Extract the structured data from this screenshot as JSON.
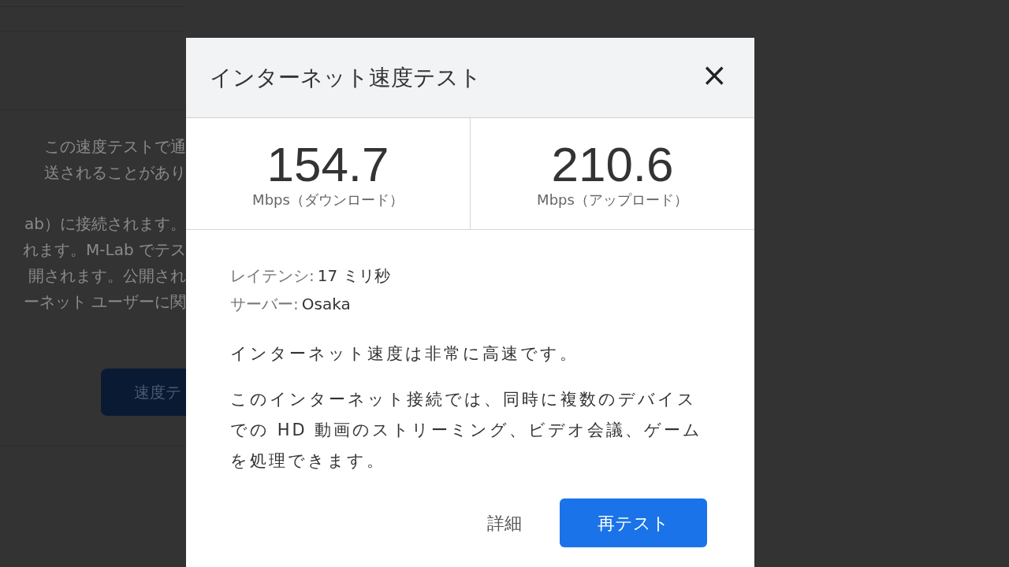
{
  "background_page": {
    "paragraph_1": [
      "この速度テストで通",
      "送されることがあり"
    ],
    "paragraph_2": [
      "ab）に接続されます。",
      "れます。M-Lab でテス",
      "開されます。公開され",
      "ーネット ユーザーに関"
    ],
    "button": "速度テ"
  },
  "dialog": {
    "title": "インターネット速度テスト",
    "close": "×",
    "results": [
      {
        "value": "154.7",
        "label": "Mbps（ダウンロード）"
      },
      {
        "value": "210.6",
        "label": "Mbps（アップロード）"
      }
    ],
    "details": [
      {
        "label": "レイテンシ:",
        "value": "17 ミリ秒"
      },
      {
        "label": "サーバー:",
        "value": "Osaka"
      }
    ],
    "summary": "インターネット速度は非常に高速です。",
    "description": "このインターネット接続では、同時に複数のデバイスでの HD 動画のストリーミング、ビデオ会議、ゲームを処理できます。",
    "buttons": [
      {
        "label": "詳細",
        "kind": "text"
      },
      {
        "label": "再テスト",
        "kind": "primary"
      }
    ]
  }
}
